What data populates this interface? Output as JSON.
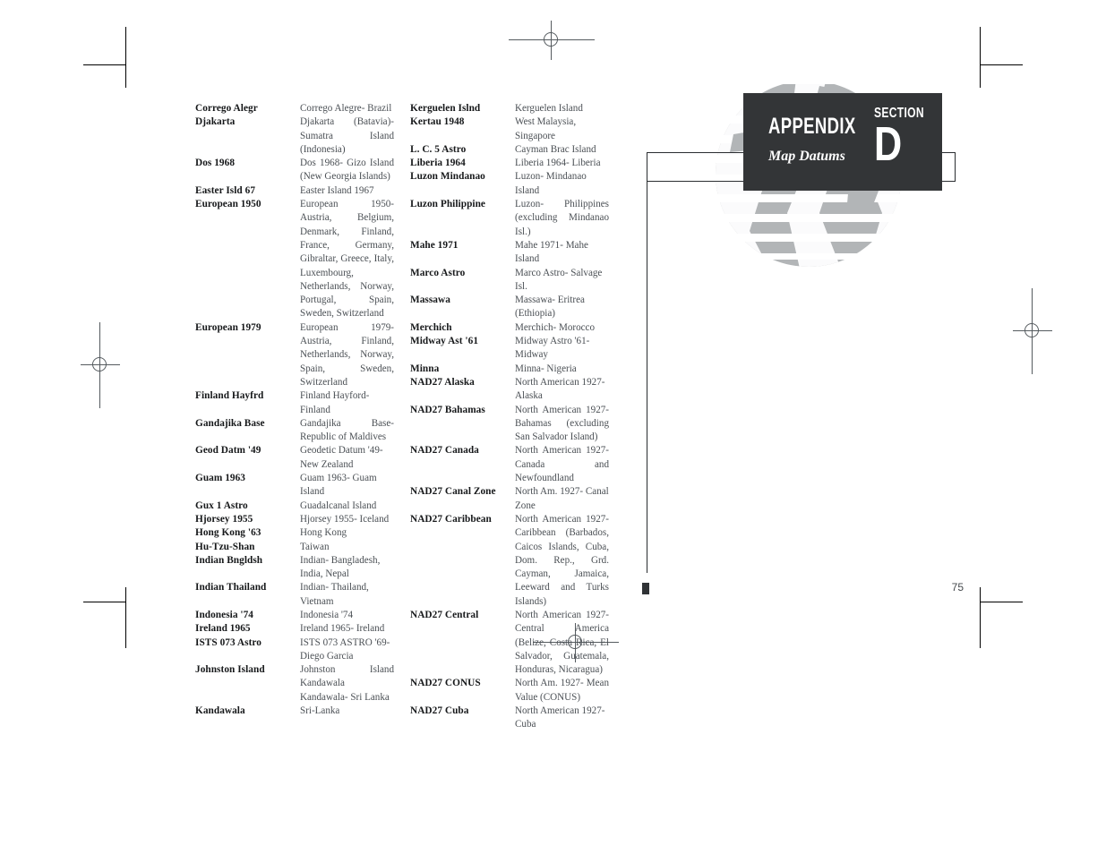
{
  "header": {
    "appendix_label": "APPENDIX",
    "subtitle": "Map Datums",
    "section_label": "SECTION",
    "section_letter": "D"
  },
  "page_number": "75",
  "columns": [
    {
      "id": "left",
      "entries": [
        {
          "name": "Corrego Alegr",
          "desc": "Corrego Alegre- Brazil"
        },
        {
          "name": "Djakarta",
          "desc": "Djakarta (Batavia)- Sumatra Island (Indonesia)"
        },
        {
          "name": "Dos 1968",
          "desc": "Dos 1968- Gizo Island (New Georgia Islands)"
        },
        {
          "name": "Easter Isld 67",
          "desc": "Easter Island 1967"
        },
        {
          "name": "European 1950",
          "desc": "European 1950- Austria, Belgium, Denmark, Finland, France, Germany, Gibraltar, Greece, Italy, Luxembourg, Netherlands, Norway, Portugal, Spain, Sweden, Switzerland"
        },
        {
          "name": "European 1979",
          "desc": "European 1979- Austria, Finland, Netherlands, Norway, Spain, Sweden, Switzerland"
        },
        {
          "name": "Finland Hayfrd",
          "desc": "Finland Hayford- Finland"
        },
        {
          "name": "Gandajika Base",
          "desc": "Gandajika Base- Republic of Maldives"
        },
        {
          "name": "Geod Datm '49",
          "desc": "Geodetic Datum '49- New Zealand"
        },
        {
          "name": "Guam 1963",
          "desc": "Guam 1963- Guam Island"
        },
        {
          "name": "Gux 1 Astro",
          "desc": "Guadalcanal Island"
        },
        {
          "name": "Hjorsey 1955",
          "desc": "Hjorsey 1955- Iceland"
        },
        {
          "name": "Hong Kong '63",
          "desc": "Hong Kong"
        },
        {
          "name": "Hu-Tzu-Shan",
          "desc": "Taiwan"
        },
        {
          "name": "Indian Bngldsh",
          "desc": "Indian- Bangladesh, India, Nepal"
        },
        {
          "name": "Indian Thailand",
          "desc": "Indian- Thailand, Vietnam"
        },
        {
          "name": "Indonesia '74",
          "desc": "Indonesia '74"
        },
        {
          "name": "Ireland 1965",
          "desc": "Ireland 1965- Ireland"
        },
        {
          "name": "ISTS 073 Astro",
          "desc": "ISTS 073 ASTRO '69- Diego Garcia"
        },
        {
          "name": "Johnston Island",
          "desc": "Johnston Island Kandawala Kandawala- Sri Lanka"
        },
        {
          "name": "Kandawala",
          "desc": "Sri-Lanka"
        }
      ]
    },
    {
      "id": "right",
      "entries": [
        {
          "name": "Kerguelen Islnd",
          "desc": "Kerguelen Island"
        },
        {
          "name": "Kertau 1948",
          "desc": "West Malaysia, Singapore"
        },
        {
          "name": "L. C. 5 Astro",
          "desc": "Cayman Brac Island"
        },
        {
          "name": "Liberia 1964",
          "desc": "Liberia 1964- Liberia"
        },
        {
          "name": "Luzon Mindanao",
          "desc": "Luzon- Mindanao Island"
        },
        {
          "name": "Luzon Philippine",
          "desc": "Luzon- Philippines (excluding Mindanao Isl.)"
        },
        {
          "name": "Mahe 1971",
          "desc": "Mahe 1971- Mahe Island"
        },
        {
          "name": "Marco Astro",
          "desc": "Marco Astro- Salvage Isl."
        },
        {
          "name": "Massawa",
          "desc": "Massawa- Eritrea (Ethiopia)"
        },
        {
          "name": "Merchich",
          "desc": "Merchich- Morocco"
        },
        {
          "name": "Midway Ast '61",
          "desc": "Midway Astro '61- Midway"
        },
        {
          "name": "Minna",
          "desc": "Minna- Nigeria"
        },
        {
          "name": "NAD27 Alaska",
          "desc": "North American 1927- Alaska"
        },
        {
          "name": "NAD27 Bahamas",
          "desc": "North American 1927- Bahamas (excluding San Salvador Island)"
        },
        {
          "name": "NAD27 Canada",
          "desc": "North American 1927- Canada and Newfoundland"
        },
        {
          "name": "NAD27 Canal Zone",
          "desc": "North Am. 1927- Canal Zone"
        },
        {
          "name": "NAD27 Caribbean",
          "desc": "North American 1927- Caribbean (Barbados, Caicos Islands, Cuba, Dom. Rep., Grd. Cayman, Jamaica, Leeward and Turks Islands)"
        },
        {
          "name": "NAD27 Central",
          "desc": "North American 1927- Central America (Belize, Costa Rica, El Salvador, Guatemala, Honduras, Nicaragua)"
        },
        {
          "name": "NAD27 CONUS",
          "desc": "North Am. 1927- Mean Value (CONUS)"
        },
        {
          "name": "NAD27 Cuba",
          "desc": "North American 1927- Cuba"
        }
      ]
    }
  ],
  "colors": {
    "header_plate": "#333537",
    "globe": "#b2b5b7",
    "body_text": "#4a4f54",
    "name_text": "#16181a"
  }
}
